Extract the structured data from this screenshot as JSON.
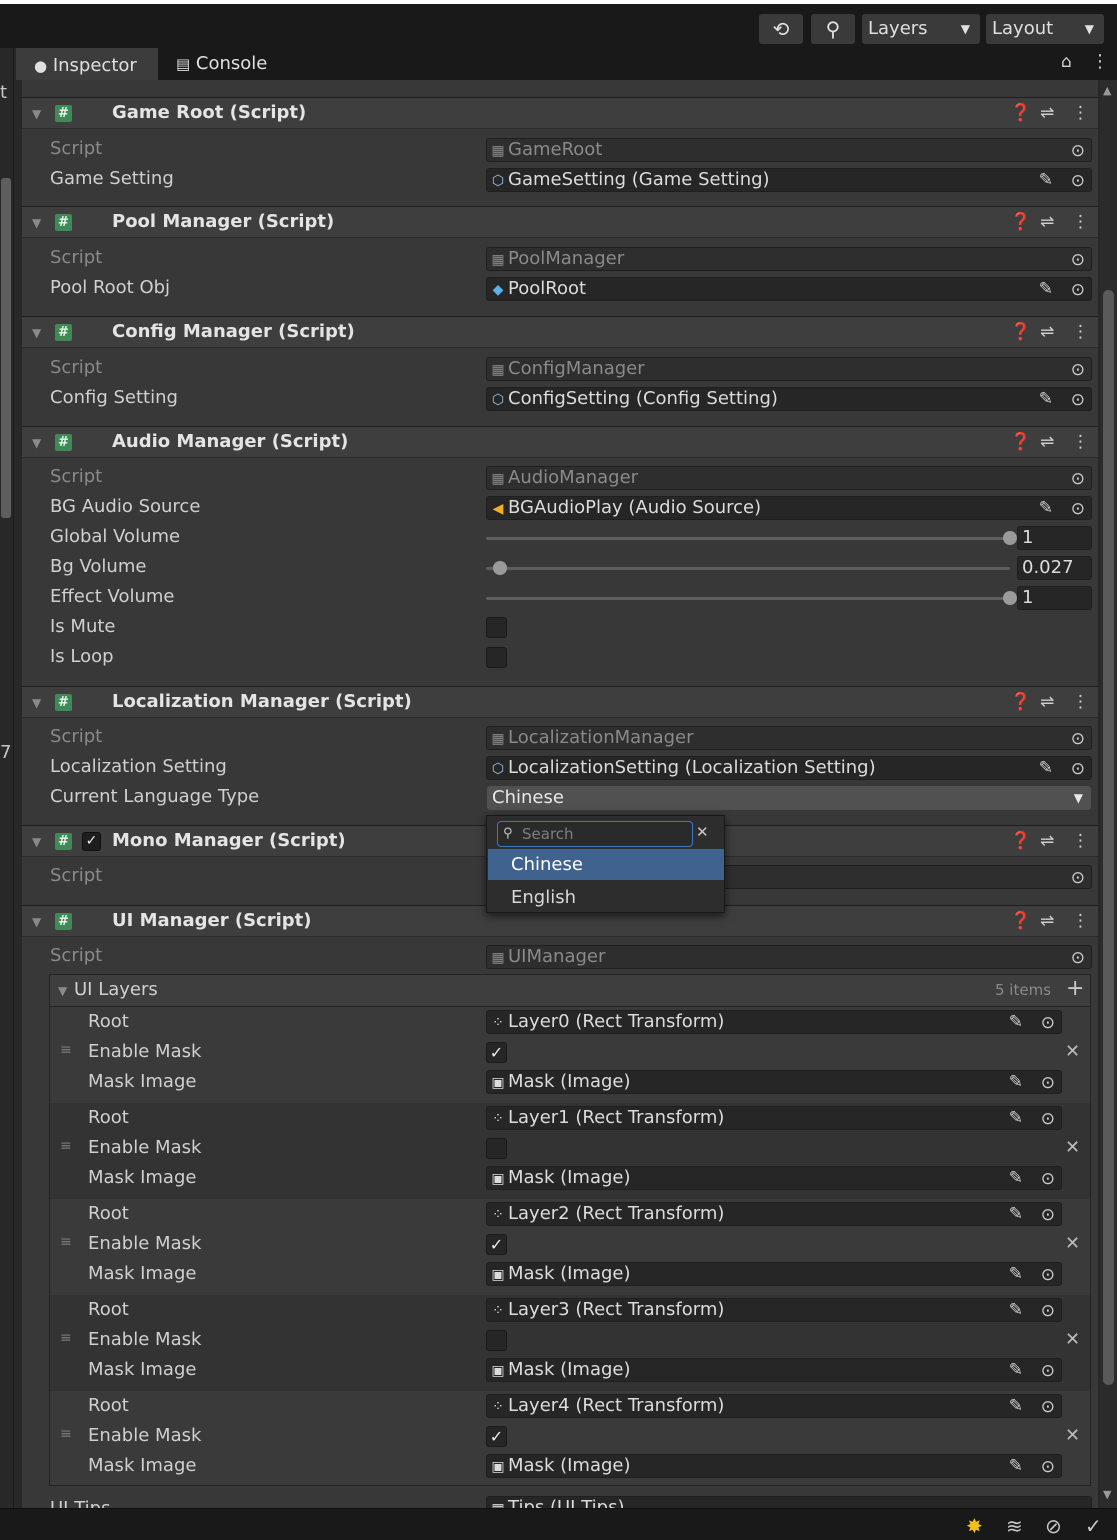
{
  "toolbar": {
    "layers_label": "Layers",
    "layout_label": "Layout",
    "history_icon": "history-icon",
    "search_icon": "search-icon"
  },
  "left_panel": {
    "fragment_top": "t",
    "fragment_mid": "7"
  },
  "tabs": [
    {
      "label": "Inspector",
      "icon": "info-icon"
    },
    {
      "label": "Console",
      "icon": "console-icon"
    }
  ],
  "components": {
    "game_root": {
      "title": "Game Root (Script)",
      "script_label": "Script",
      "script_value": "GameRoot",
      "prop_label": "Game Setting",
      "prop_value": "GameSetting (Game Setting)"
    },
    "pool_manager": {
      "title": "Pool Manager (Script)",
      "script_label": "Script",
      "script_value": "PoolManager",
      "prop_label": "Pool Root Obj",
      "prop_value": "PoolRoot"
    },
    "config_manager": {
      "title": "Config Manager (Script)",
      "script_label": "Script",
      "script_value": "ConfigManager",
      "prop_label": "Config Setting",
      "prop_value": "ConfigSetting (Config Setting)"
    },
    "audio_manager": {
      "title": "Audio Manager (Script)",
      "script_label": "Script",
      "script_value": "AudioManager",
      "bg_source_label": "BG Audio Source",
      "bg_source_value": "BGAudioPlay (Audio Source)",
      "global_volume_label": "Global Volume",
      "global_volume": "1",
      "global_volume_level": 1.0,
      "bg_volume_label": "Bg Volume",
      "bg_volume": "0.027",
      "bg_volume_level": 0.027,
      "effect_volume_label": "Effect Volume",
      "effect_volume": "1",
      "effect_volume_level": 1.0,
      "is_mute_label": "Is Mute",
      "is_mute": false,
      "is_loop_label": "Is Loop",
      "is_loop": false
    },
    "localization_manager": {
      "title": "Localization Manager (Script)",
      "script_label": "Script",
      "script_value": "LocalizationManager",
      "setting_label": "Localization Setting",
      "setting_value": "LocalizationSetting (Localization Setting)",
      "lang_label": "Current Language Type",
      "lang_value": "Chinese"
    },
    "mono_manager": {
      "title": "Mono Manager (Script)",
      "script_label": "Script",
      "enabled": true
    },
    "ui_manager": {
      "title": "UI Manager (Script)",
      "script_label": "Script",
      "script_value": "UIManager",
      "list_label": "UI Layers",
      "list_count": "5 items",
      "root_label": "Root",
      "enable_label": "Enable Mask",
      "mask_label": "Mask Image",
      "layers": [
        {
          "root": "Layer0 (Rect Transform)",
          "enable": true,
          "mask": "Mask (Image)"
        },
        {
          "root": "Layer1 (Rect Transform)",
          "enable": false,
          "mask": "Mask (Image)"
        },
        {
          "root": "Layer2 (Rect Transform)",
          "enable": true,
          "mask": "Mask (Image)"
        },
        {
          "root": "Layer3 (Rect Transform)",
          "enable": false,
          "mask": "Mask (Image)"
        },
        {
          "root": "Layer4 (Rect Transform)",
          "enable": true,
          "mask": "Mask (Image)"
        }
      ],
      "next_label": "UI Tips",
      "next_value": "Tips (UI Tips)"
    }
  },
  "language_popup": {
    "search_placeholder": "Search",
    "options": [
      "Chinese",
      "English"
    ],
    "selected": "Chinese"
  },
  "colors": {
    "accent": "#3f628f",
    "script_icon": "#3f8a57",
    "focus": "#3d7ac2"
  }
}
